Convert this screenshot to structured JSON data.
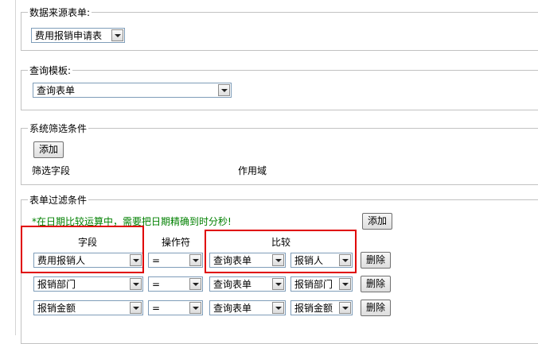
{
  "source_form": {
    "legend": "数据来源表单",
    "selected": "费用报销申请表"
  },
  "query_template": {
    "legend": "查询模板",
    "selected": "查询表单"
  },
  "system_filter": {
    "legend": "系统筛选条件",
    "add_label": "添加",
    "col_field": "筛选字段",
    "col_scope": "作用域"
  },
  "form_filter": {
    "legend": "表单过滤条件",
    "hint": "*在日期比较运算中，需要把日期精确到时分秒!",
    "add_label": "添加",
    "headers": {
      "field": "字段",
      "operator": "操作符",
      "compare": "比较"
    },
    "rows": [
      {
        "field": "费用报销人",
        "operator": "=",
        "compare_source": "查询表单",
        "compare_field": "报销人",
        "delete_label": "删除"
      },
      {
        "field": "报销部门",
        "operator": "=",
        "compare_source": "查询表单",
        "compare_field": "报销部门",
        "delete_label": "删除"
      },
      {
        "field": "报销金额",
        "operator": "=",
        "compare_source": "查询表单",
        "compare_field": "报销金额",
        "delete_label": "删除"
      }
    ]
  },
  "colors": {
    "highlight": "#e00000",
    "hint": "#008000",
    "select_border": "#7f9db9"
  },
  "icons": {
    "dropdown": "chevron-down-icon"
  }
}
